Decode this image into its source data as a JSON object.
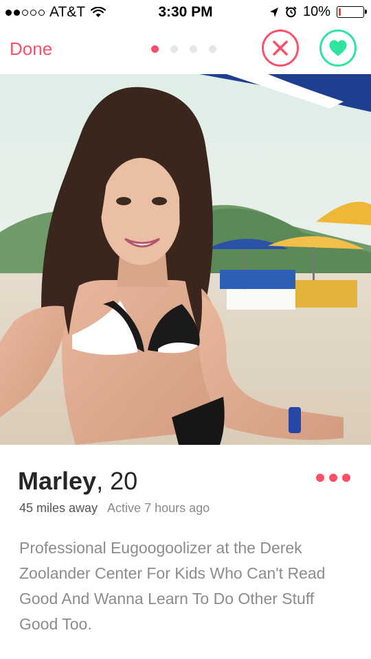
{
  "status_bar": {
    "carrier": "AT&T",
    "time": "3:30 PM",
    "battery": "10%",
    "battery_level": 0.1,
    "signal_bars_filled": 2,
    "signal_bars_total": 5
  },
  "nav": {
    "done_label": "Done",
    "photo_count": 4,
    "active_photo_index": 0
  },
  "photo": {
    "subject": "profile-photo"
  },
  "profile": {
    "name": "Marley",
    "age_text": ", 20",
    "distance": "45 miles away",
    "active": "Active 7 hours ago",
    "bio": "Professional Eugoogoolizer at the Derek Zoolander Center For Kids Who Can't Read Good And Wanna Learn To Do Other Stuff Good Too."
  },
  "colors": {
    "accent_red": "#fd5068",
    "accent_green": "#2ee5a0",
    "text_dark": "#262626",
    "text_muted": "#8c8c8c"
  },
  "icons": {
    "nope": "x-icon",
    "like": "heart-icon",
    "more": "more-dots-icon",
    "wifi": "wifi-icon",
    "location": "location-arrow-icon",
    "alarm": "alarm-icon"
  }
}
